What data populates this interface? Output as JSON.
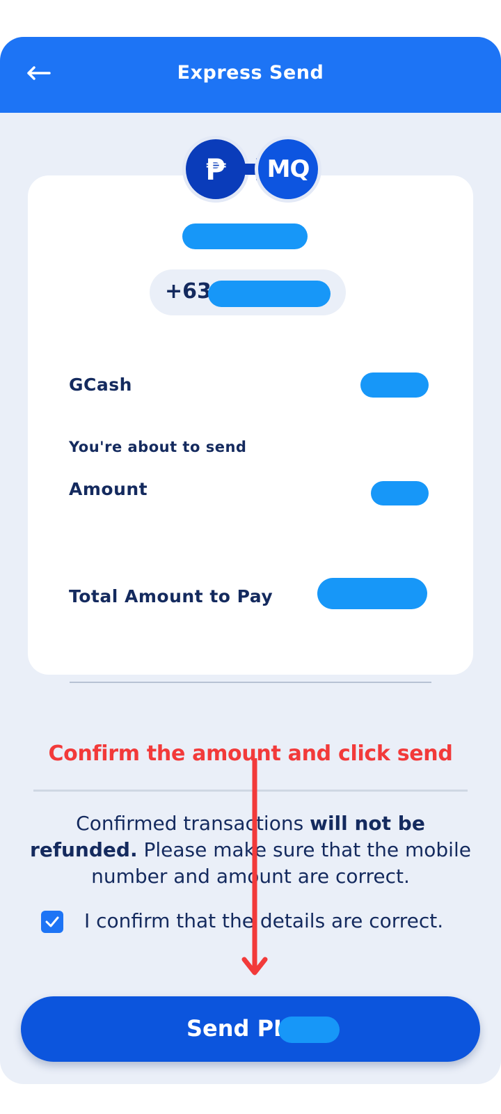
{
  "header": {
    "title": "Express Send",
    "back_icon": "arrow-left-icon"
  },
  "logos": {
    "source_symbol": "₱",
    "destination_text": "MQ",
    "connector_icon": "arrow-right-icon"
  },
  "recipient": {
    "phone_prefix": "+63"
  },
  "details": {
    "wallet_label": "GCash",
    "sending_caption": "You're about to send",
    "amount_label": "Amount",
    "total_label": "Total Amount to Pay"
  },
  "annotation": {
    "text": "Confirm the amount and click send",
    "color": "#f23a3a"
  },
  "notice": {
    "part1": "Confirmed transactions ",
    "bold": "will not be refunded.",
    "part2": " Please make sure that the mobile number and amount are correct."
  },
  "confirm": {
    "checked": true,
    "label": "I confirm that the details are correct."
  },
  "send_button": {
    "label": "Send PHP"
  },
  "colors": {
    "header": "#1d74f5",
    "primary_button": "#0c55dd",
    "text_dark": "#142a5e",
    "redaction": "#1797f8",
    "background": "#eaeff8"
  }
}
